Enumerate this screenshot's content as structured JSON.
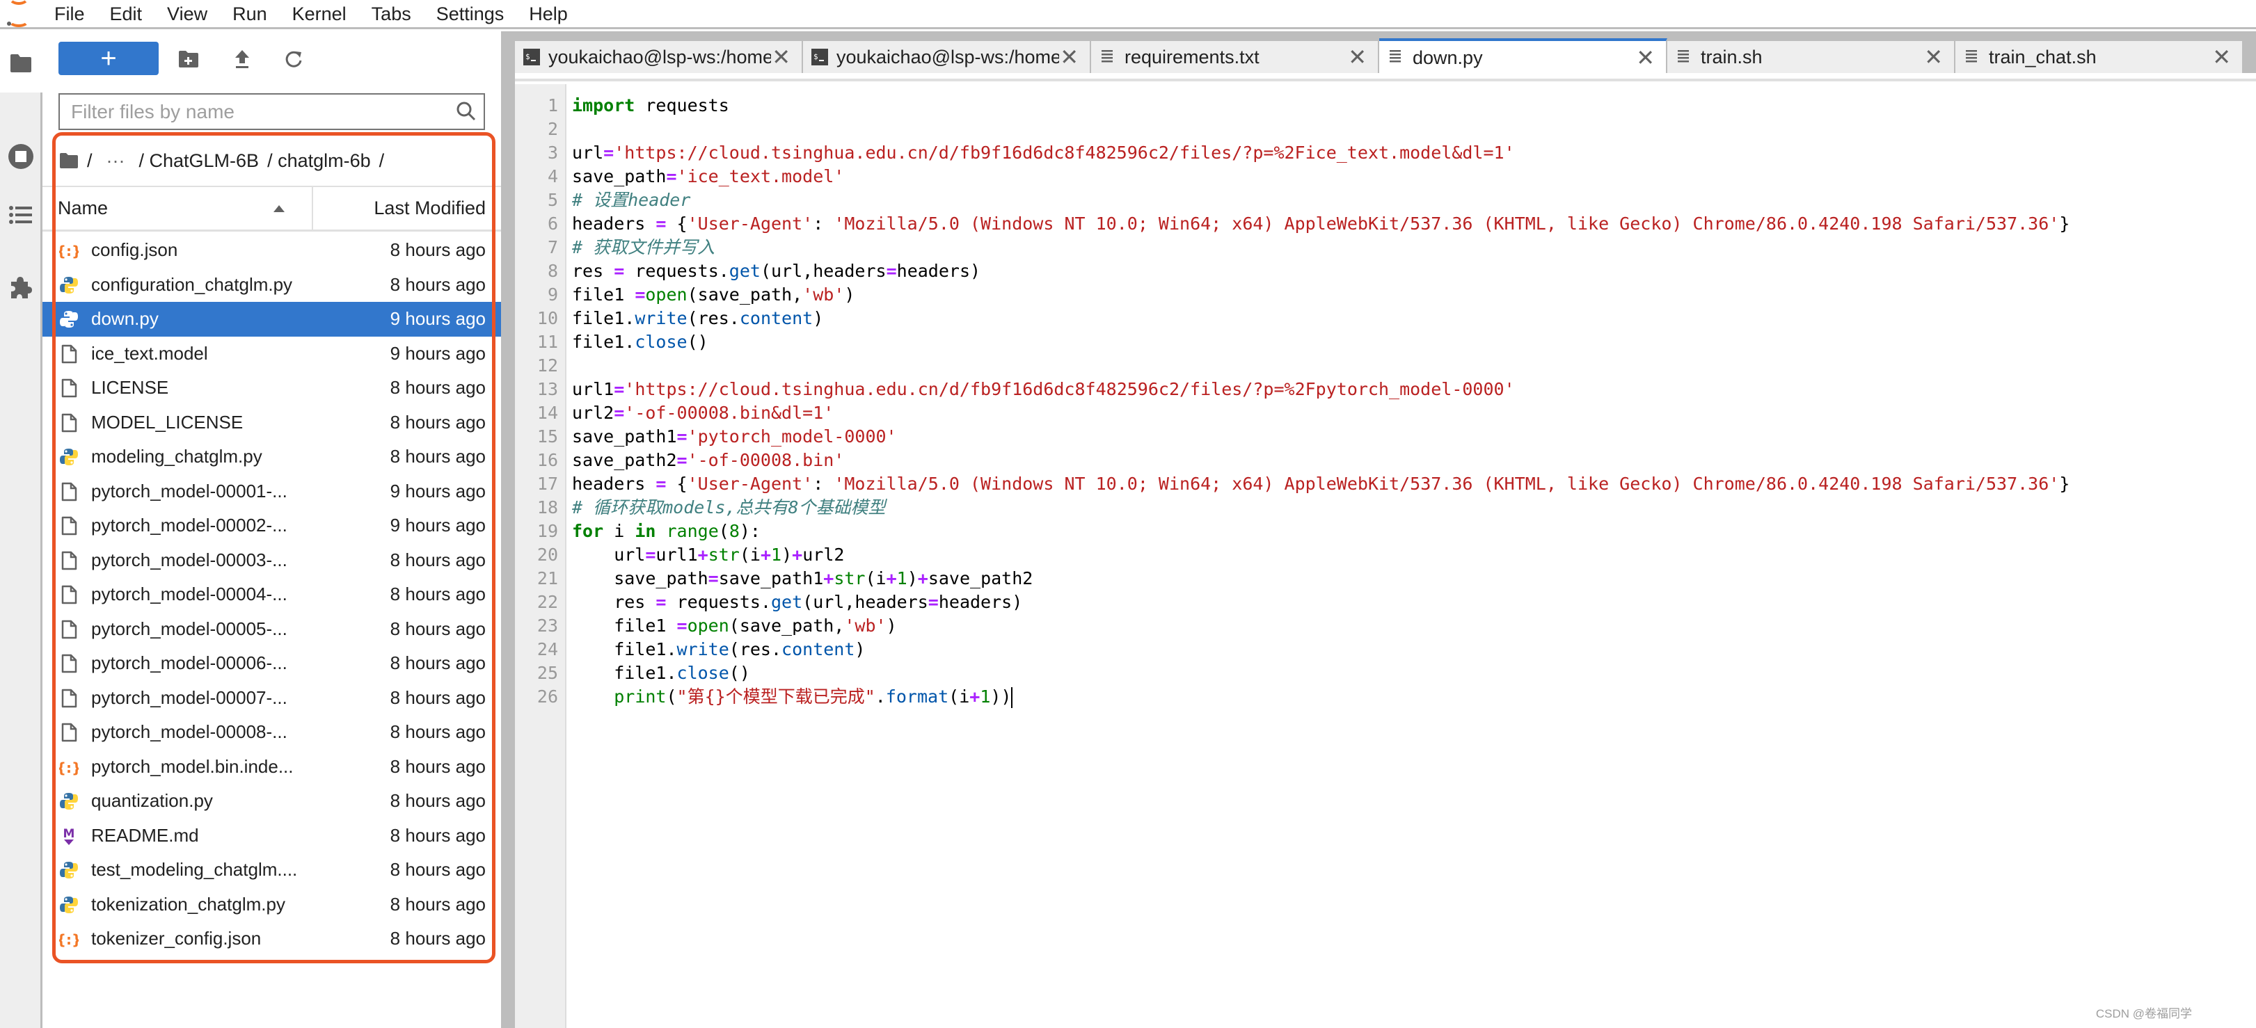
{
  "menubar": {
    "items": [
      "File",
      "Edit",
      "View",
      "Run",
      "Kernel",
      "Tabs",
      "Settings",
      "Help"
    ]
  },
  "activity_bar": {
    "icons": [
      "folder-icon",
      "running-sessions-icon",
      "table-of-contents-icon",
      "extensions-icon"
    ]
  },
  "file_browser": {
    "toolbar": {
      "new_launcher_label": "+",
      "new_folder_icon": "new-folder-icon",
      "upload_icon": "upload-icon",
      "refresh_icon": "refresh-icon"
    },
    "filter": {
      "placeholder": "Filter files by name",
      "value": ""
    },
    "breadcrumb": {
      "root": "/",
      "ellipsis": "···",
      "segments": [
        "/ ChatGLM-6B",
        "/ chatglm-6b",
        "/"
      ]
    },
    "columns": {
      "name": "Name",
      "modified": "Last Modified",
      "sort": "ascending"
    },
    "files": [
      {
        "name": "config.json",
        "modified": "8 hours ago",
        "type": "json",
        "selected": false
      },
      {
        "name": "configuration_chatglm.py",
        "modified": "8 hours ago",
        "type": "python",
        "selected": false
      },
      {
        "name": "down.py",
        "modified": "9 hours ago",
        "type": "python",
        "selected": true
      },
      {
        "name": "ice_text.model",
        "modified": "9 hours ago",
        "type": "file",
        "selected": false
      },
      {
        "name": "LICENSE",
        "modified": "8 hours ago",
        "type": "file",
        "selected": false
      },
      {
        "name": "MODEL_LICENSE",
        "modified": "8 hours ago",
        "type": "file",
        "selected": false
      },
      {
        "name": "modeling_chatglm.py",
        "modified": "8 hours ago",
        "type": "python",
        "selected": false
      },
      {
        "name": "pytorch_model-00001-...",
        "modified": "9 hours ago",
        "type": "file",
        "selected": false
      },
      {
        "name": "pytorch_model-00002-...",
        "modified": "9 hours ago",
        "type": "file",
        "selected": false
      },
      {
        "name": "pytorch_model-00003-...",
        "modified": "8 hours ago",
        "type": "file",
        "selected": false
      },
      {
        "name": "pytorch_model-00004-...",
        "modified": "8 hours ago",
        "type": "file",
        "selected": false
      },
      {
        "name": "pytorch_model-00005-...",
        "modified": "8 hours ago",
        "type": "file",
        "selected": false
      },
      {
        "name": "pytorch_model-00006-...",
        "modified": "8 hours ago",
        "type": "file",
        "selected": false
      },
      {
        "name": "pytorch_model-00007-...",
        "modified": "8 hours ago",
        "type": "file",
        "selected": false
      },
      {
        "name": "pytorch_model-00008-...",
        "modified": "8 hours ago",
        "type": "file",
        "selected": false
      },
      {
        "name": "pytorch_model.bin.inde...",
        "modified": "8 hours ago",
        "type": "json",
        "selected": false
      },
      {
        "name": "quantization.py",
        "modified": "8 hours ago",
        "type": "python",
        "selected": false
      },
      {
        "name": "README.md",
        "modified": "8 hours ago",
        "type": "markdown",
        "selected": false
      },
      {
        "name": "test_modeling_chatglm....",
        "modified": "8 hours ago",
        "type": "python",
        "selected": false
      },
      {
        "name": "tokenization_chatglm.py",
        "modified": "8 hours ago",
        "type": "python",
        "selected": false
      },
      {
        "name": "tokenizer_config.json",
        "modified": "8 hours ago",
        "type": "json",
        "selected": false
      }
    ],
    "highlight_color": "#ea5325"
  },
  "tabs": [
    {
      "label": "youkaichao@lsp-ws:/home",
      "type": "terminal",
      "active": false
    },
    {
      "label": "youkaichao@lsp-ws:/home",
      "type": "terminal",
      "active": false
    },
    {
      "label": "requirements.txt",
      "type": "text",
      "active": false
    },
    {
      "label": "down.py",
      "type": "text",
      "active": true
    },
    {
      "label": "train.sh",
      "type": "text",
      "active": false
    },
    {
      "label": "train_chat.sh",
      "type": "text",
      "active": false
    }
  ],
  "editor": {
    "filename": "down.py",
    "lines": [
      [
        [
          "kw",
          "import"
        ],
        [
          "",
          " requests"
        ]
      ],
      [],
      [
        [
          "",
          "url"
        ],
        [
          "op",
          "="
        ],
        [
          "str",
          "'https://cloud.tsinghua.edu.cn/d/fb9f16d6dc8f482596c2/files/?p=%2Fice_text.model&dl=1'"
        ]
      ],
      [
        [
          "",
          "save_path"
        ],
        [
          "op",
          "="
        ],
        [
          "str",
          "'ice_text.model'"
        ]
      ],
      [
        [
          "cm",
          "# 设置header"
        ]
      ],
      [
        [
          "",
          "headers "
        ],
        [
          "op",
          "="
        ],
        [
          "",
          " {"
        ],
        [
          "str",
          "'User-Agent'"
        ],
        [
          "",
          ": "
        ],
        [
          "str",
          "'Mozilla/5.0 (Windows NT 10.0; Win64; x64) AppleWebKit/537.36 (KHTML, like Gecko) Chrome/86.0.4240.198 Safari/537.36'"
        ],
        [
          "",
          "}"
        ]
      ],
      [
        [
          "cm",
          "# 获取文件并写入"
        ]
      ],
      [
        [
          "",
          "res "
        ],
        [
          "op",
          "="
        ],
        [
          "",
          " requests."
        ],
        [
          "pr",
          "get"
        ],
        [
          "",
          "(url,headers"
        ],
        [
          "op",
          "="
        ],
        [
          "",
          "headers)"
        ]
      ],
      [
        [
          "",
          "file1 "
        ],
        [
          "op",
          "="
        ],
        [
          "bi",
          "open"
        ],
        [
          "",
          "(save_path,"
        ],
        [
          "str",
          "'wb'"
        ],
        [
          "",
          ")"
        ]
      ],
      [
        [
          "",
          "file1."
        ],
        [
          "pr",
          "write"
        ],
        [
          "",
          "(res."
        ],
        [
          "pr",
          "content"
        ],
        [
          "",
          ")"
        ]
      ],
      [
        [
          "",
          "file1."
        ],
        [
          "pr",
          "close"
        ],
        [
          "",
          "()"
        ]
      ],
      [],
      [
        [
          "",
          "url1"
        ],
        [
          "op",
          "="
        ],
        [
          "str",
          "'https://cloud.tsinghua.edu.cn/d/fb9f16d6dc8f482596c2/files/?p=%2Fpytorch_model-0000'"
        ]
      ],
      [
        [
          "",
          "url2"
        ],
        [
          "op",
          "="
        ],
        [
          "str",
          "'-of-00008.bin&dl=1'"
        ]
      ],
      [
        [
          "",
          "save_path1"
        ],
        [
          "op",
          "="
        ],
        [
          "str",
          "'pytorch_model-0000'"
        ]
      ],
      [
        [
          "",
          "save_path2"
        ],
        [
          "op",
          "="
        ],
        [
          "str",
          "'-of-00008.bin'"
        ]
      ],
      [
        [
          "",
          "headers "
        ],
        [
          "op",
          "="
        ],
        [
          "",
          " {"
        ],
        [
          "str",
          "'User-Agent'"
        ],
        [
          "",
          ": "
        ],
        [
          "str",
          "'Mozilla/5.0 (Windows NT 10.0; Win64; x64) AppleWebKit/537.36 (KHTML, like Gecko) Chrome/86.0.4240.198 Safari/537.36'"
        ],
        [
          "",
          "}"
        ]
      ],
      [
        [
          "cm",
          "# 循环获取models,总共有8个基础模型"
        ]
      ],
      [
        [
          "kw",
          "for"
        ],
        [
          "",
          " i "
        ],
        [
          "kw",
          "in"
        ],
        [
          "",
          " "
        ],
        [
          "bi",
          "range"
        ],
        [
          "",
          "("
        ],
        [
          "num",
          "8"
        ],
        [
          "",
          "):"
        ]
      ],
      [
        [
          "",
          "    url"
        ],
        [
          "op",
          "="
        ],
        [
          "",
          "url1"
        ],
        [
          "op",
          "+"
        ],
        [
          "bi",
          "str"
        ],
        [
          "",
          "(i"
        ],
        [
          "op",
          "+"
        ],
        [
          "num",
          "1"
        ],
        [
          "",
          ")"
        ],
        [
          "op",
          "+"
        ],
        [
          "",
          "url2"
        ]
      ],
      [
        [
          "",
          "    save_path"
        ],
        [
          "op",
          "="
        ],
        [
          "",
          "save_path1"
        ],
        [
          "op",
          "+"
        ],
        [
          "bi",
          "str"
        ],
        [
          "",
          "(i"
        ],
        [
          "op",
          "+"
        ],
        [
          "num",
          "1"
        ],
        [
          "",
          ")"
        ],
        [
          "op",
          "+"
        ],
        [
          "",
          "save_path2"
        ]
      ],
      [
        [
          "",
          "    res "
        ],
        [
          "op",
          "="
        ],
        [
          "",
          " requests."
        ],
        [
          "pr",
          "get"
        ],
        [
          "",
          "(url,headers"
        ],
        [
          "op",
          "="
        ],
        [
          "",
          "headers)"
        ]
      ],
      [
        [
          "",
          "    file1 "
        ],
        [
          "op",
          "="
        ],
        [
          "bi",
          "open"
        ],
        [
          "",
          "(save_path,"
        ],
        [
          "str",
          "'wb'"
        ],
        [
          "",
          ")"
        ]
      ],
      [
        [
          "",
          "    file1."
        ],
        [
          "pr",
          "write"
        ],
        [
          "",
          "(res."
        ],
        [
          "pr",
          "content"
        ],
        [
          "",
          ")"
        ]
      ],
      [
        [
          "",
          "    file1."
        ],
        [
          "pr",
          "close"
        ],
        [
          "",
          "()"
        ]
      ],
      [
        [
          "",
          "    "
        ],
        [
          "bi",
          "print"
        ],
        [
          "",
          "("
        ],
        [
          "str",
          "\"第{}个模型下载已完成\""
        ],
        [
          "",
          "."
        ],
        [
          "pr",
          "format"
        ],
        [
          "",
          "(i"
        ],
        [
          "op",
          "+"
        ],
        [
          "num",
          "1"
        ],
        [
          "",
          "))"
        ]
      ]
    ],
    "cursor_line": 26
  },
  "watermark": "CSDN @卷福同学"
}
